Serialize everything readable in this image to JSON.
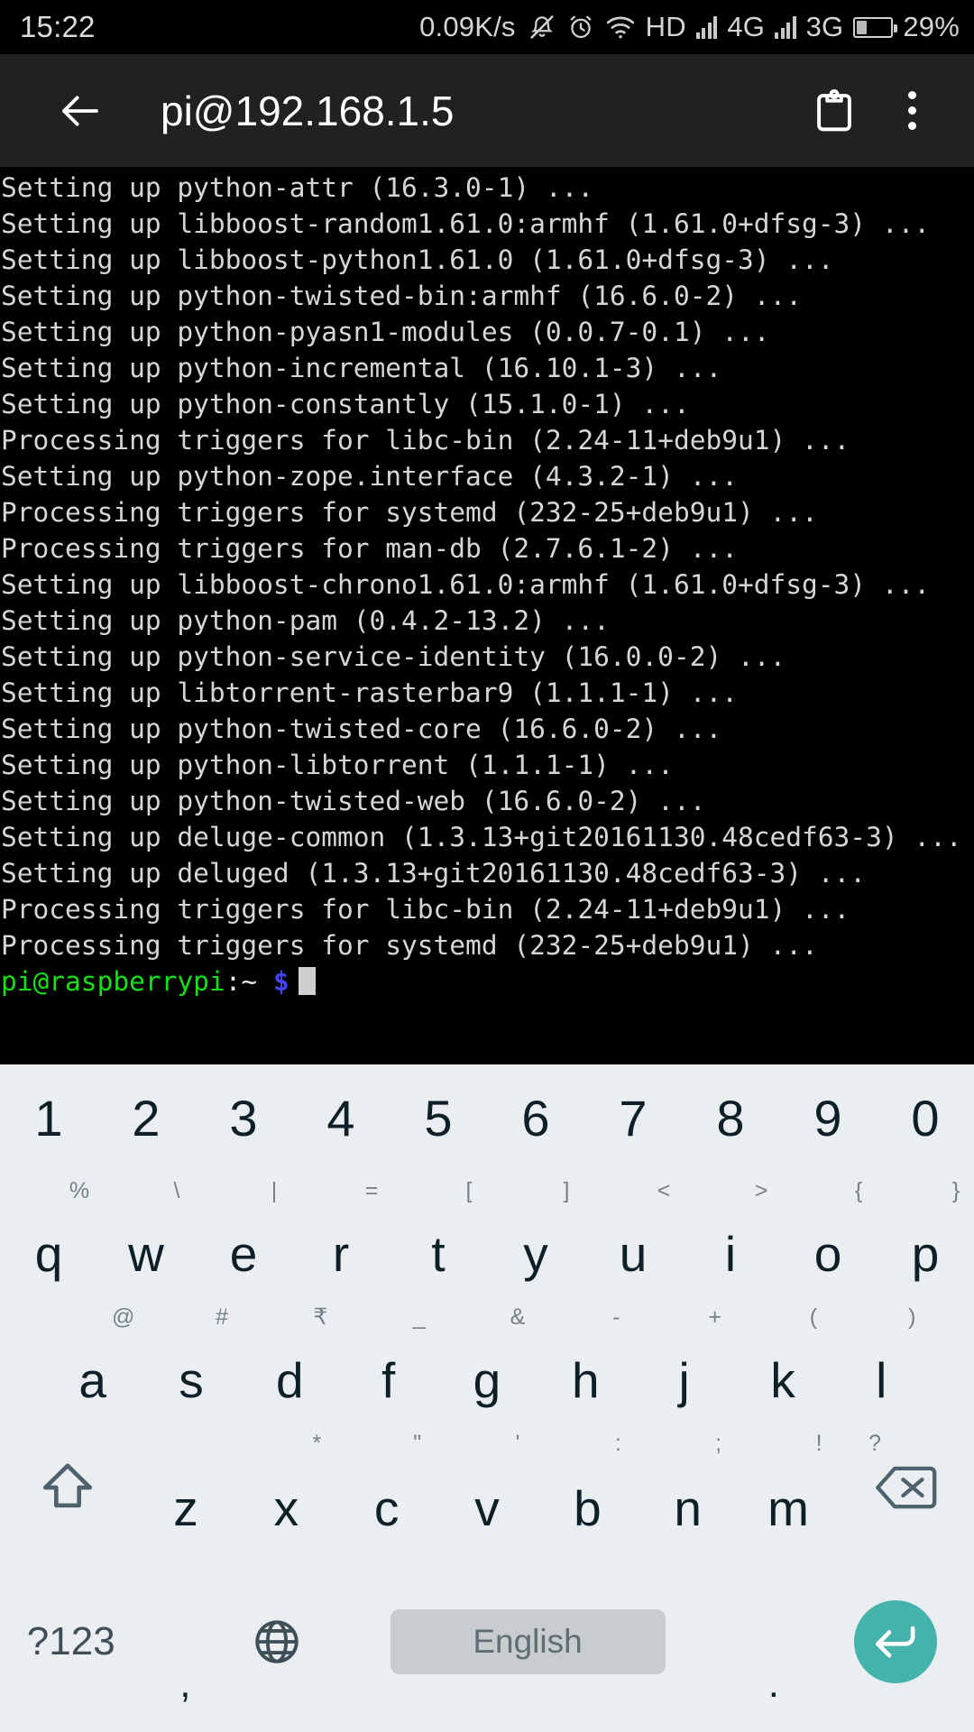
{
  "statusbar": {
    "time": "15:22",
    "net_speed": "0.09K/s",
    "mute_icon": "bell-muted-icon",
    "alarm_icon": "alarm-clock-icon",
    "wifi_icon": "wifi-icon",
    "hd_label": "HD",
    "sim1_network": "4G",
    "sim2_network": "3G",
    "battery_percent": "29%",
    "battery_level": 29,
    "colors": {
      "text": "#d4d4d4",
      "background": "#000000"
    }
  },
  "appbar": {
    "back_icon": "back-arrow-icon",
    "title": "pi@192.168.1.5",
    "clipboard_icon": "clipboard-icon",
    "overflow_icon": "more-vertical-icon",
    "colors": {
      "background": "#212121",
      "text": "#ffffff"
    }
  },
  "terminal": {
    "colors": {
      "background": "#000000",
      "text": "#d6d6d6",
      "prompt_user": "#18e018",
      "prompt_path": "#e6e6e6",
      "prompt_symbol": "#4444ee",
      "cursor": "#cfcfcf"
    },
    "lines": [
      "Setting up python-attr (16.3.0-1) ...",
      "Setting up libboost-random1.61.0:armhf (1.61.0+dfsg-3) ...",
      "Setting up libboost-python1.61.0 (1.61.0+dfsg-3) ...",
      "Setting up python-twisted-bin:armhf (16.6.0-2) ...",
      "Setting up python-pyasn1-modules (0.0.7-0.1) ...",
      "Setting up python-incremental (16.10.1-3) ...",
      "Setting up python-constantly (15.1.0-1) ...",
      "Processing triggers for libc-bin (2.24-11+deb9u1) ...",
      "Setting up python-zope.interface (4.3.2-1) ...",
      "Processing triggers for systemd (232-25+deb9u1) ...",
      "Processing triggers for man-db (2.7.6.1-2) ...",
      "Setting up libboost-chrono1.61.0:armhf (1.61.0+dfsg-3) ...",
      "Setting up python-pam (0.4.2-13.2) ...",
      "Setting up python-service-identity (16.0.0-2) ...",
      "Setting up libtorrent-rasterbar9 (1.1.1-1) ...",
      "Setting up python-twisted-core (16.6.0-2) ...",
      "Setting up python-libtorrent (1.1.1-1) ...",
      "Setting up python-twisted-web (16.6.0-2) ...",
      "Setting up deluge-common (1.3.13+git20161130.48cedf63-3) ...",
      "Setting up deluged (1.3.13+git20161130.48cedf63-3) ...",
      "Processing triggers for libc-bin (2.24-11+deb9u1) ...",
      "Processing triggers for systemd (232-25+deb9u1) ..."
    ],
    "prompt": {
      "user_host": "pi@raspberrypi",
      "path": ":~",
      "symbol": "$"
    }
  },
  "keyboard": {
    "colors": {
      "background": "#eaeef1",
      "key_text": "#0d2028",
      "sup_text": "#73818a",
      "spacebar_bg": "#c8ccce",
      "spacebar_text": "#5f6d75",
      "enter_bg": "#44b3ab",
      "enter_icon": "#ffffff"
    },
    "row_numbers": [
      "1",
      "2",
      "3",
      "4",
      "5",
      "6",
      "7",
      "8",
      "9",
      "0"
    ],
    "row_q": [
      {
        "main": "q",
        "sup": "%"
      },
      {
        "main": "w",
        "sup": "\\"
      },
      {
        "main": "e",
        "sup": "|"
      },
      {
        "main": "r",
        "sup": "="
      },
      {
        "main": "t",
        "sup": "["
      },
      {
        "main": "y",
        "sup": "]"
      },
      {
        "main": "u",
        "sup": "<"
      },
      {
        "main": "i",
        "sup": ">"
      },
      {
        "main": "o",
        "sup": "{"
      },
      {
        "main": "p",
        "sup": "}"
      }
    ],
    "row_a": [
      {
        "main": "a",
        "sup": "@"
      },
      {
        "main": "s",
        "sup": "#"
      },
      {
        "main": "d",
        "sup": "₹"
      },
      {
        "main": "f",
        "sup": "_"
      },
      {
        "main": "g",
        "sup": "&"
      },
      {
        "main": "h",
        "sup": "-"
      },
      {
        "main": "j",
        "sup": "+"
      },
      {
        "main": "k",
        "sup": "("
      },
      {
        "main": "l",
        "sup": ")"
      }
    ],
    "row_z": [
      {
        "main": "z",
        "sup": ""
      },
      {
        "main": "x",
        "sup": "*"
      },
      {
        "main": "c",
        "sup": "\""
      },
      {
        "main": "v",
        "sup": "'"
      },
      {
        "main": "b",
        "sup": ":"
      },
      {
        "main": "n",
        "sup": ";"
      },
      {
        "main": "m",
        "sup": "!"
      }
    ],
    "row_z_extra_sup": "?",
    "shift_icon": "shift-arrow-icon",
    "backspace_icon": "backspace-icon",
    "bottom": {
      "symbols_key": "?123",
      "comma_key": ",",
      "globe_icon": "globe-language-icon",
      "spacebar_label": "English",
      "period_key": ".",
      "enter_icon": "enter-return-icon"
    }
  }
}
